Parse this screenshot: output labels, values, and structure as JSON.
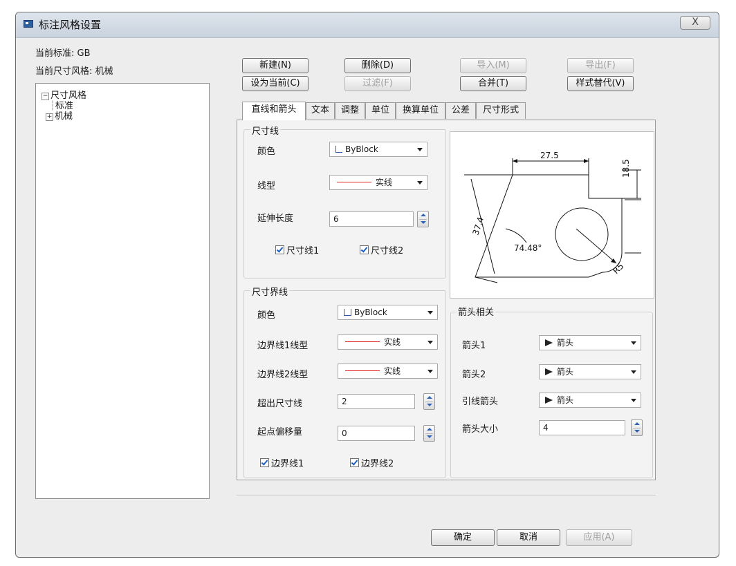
{
  "window": {
    "title": "标注风格设置",
    "close_label": "X"
  },
  "info": {
    "current_standard": "当前标准: GB",
    "current_style": "当前尺寸风格: 机械"
  },
  "tree": {
    "root": "尺寸风格",
    "children": [
      "标准",
      "机械"
    ]
  },
  "buttons": {
    "new": "新建(N)",
    "delete": "删除(D)",
    "import": "导入(M)",
    "export": "导出(F)",
    "set_current": "设为当前(C)",
    "filter": "过滤(F)",
    "merge": "合并(T)",
    "override": "样式替代(V)"
  },
  "tabs": [
    "直线和箭头",
    "文本",
    "调整",
    "单位",
    "换算单位",
    "公差",
    "尺寸形式"
  ],
  "dimension_line": {
    "title": "尺寸线",
    "color_label": "颜色",
    "color_value": "ByBlock",
    "linetype_label": "线型",
    "linetype_value": "实线",
    "extend_label": "延伸长度",
    "extend_value": "6",
    "check1": "尺寸线1",
    "check2": "尺寸线2"
  },
  "extension_line": {
    "title": "尺寸界线",
    "color_label": "颜色",
    "color_value": "ByBlock",
    "lt1_label": "边界线1线型",
    "lt1_value": "实线",
    "lt2_label": "边界线2线型",
    "lt2_value": "实线",
    "beyond_label": "超出尺寸线",
    "beyond_value": "2",
    "offset_label": "起点偏移量",
    "offset_value": "0",
    "check1": "边界线1",
    "check2": "边界线2"
  },
  "arrows": {
    "title": "箭头相关",
    "arrow1_label": "箭头1",
    "arrow1_value": "箭头",
    "arrow2_label": "箭头2",
    "arrow2_value": "箭头",
    "leader_label": "引线箭头",
    "leader_value": "箭头",
    "size_label": "箭头大小",
    "size_value": "4"
  },
  "preview": {
    "dim_top": "27.5",
    "dim_right": "18.5",
    "dim_left": "37.4",
    "dim_angle": "74.48°",
    "dim_radius": "R5"
  },
  "footer": {
    "ok": "确定",
    "cancel": "取消",
    "apply": "应用(A)"
  }
}
